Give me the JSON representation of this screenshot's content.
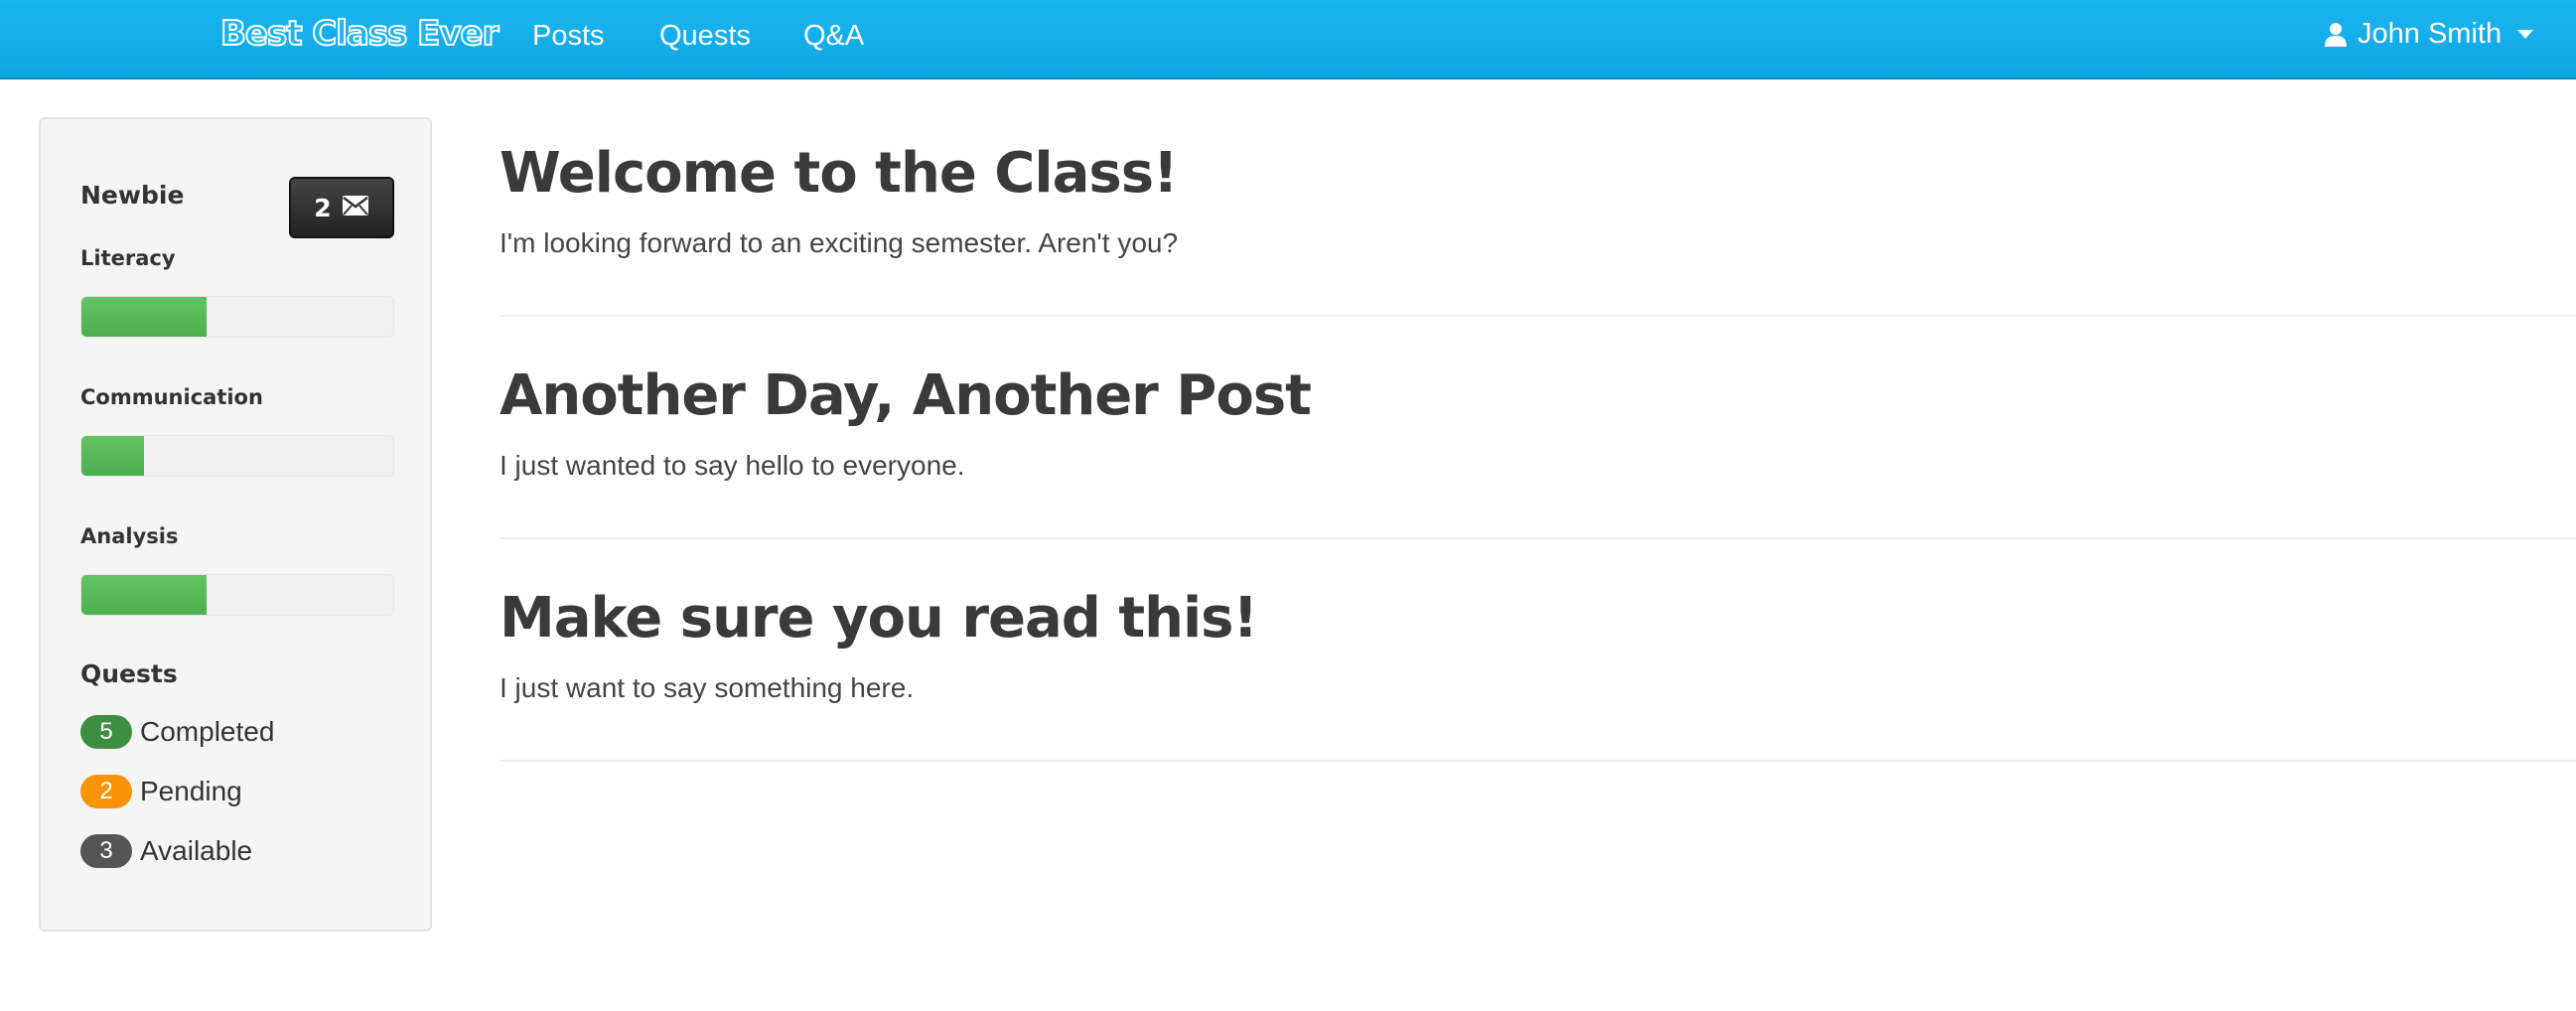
{
  "navbar": {
    "brand": "Best Class Ever",
    "links": [
      "Posts",
      "Quests",
      "Q&A"
    ],
    "user": "John Smith",
    "colors": {
      "bar": "#1ab6f1",
      "text": "#ffffff"
    }
  },
  "sidebar": {
    "rank": "Newbie",
    "messages_count": "2",
    "skills": [
      {
        "label": "Literacy",
        "progress": 0.4
      },
      {
        "label": "Communication",
        "progress": 0.2
      },
      {
        "label": "Analysis",
        "progress": 0.4
      }
    ],
    "quests_title": "Quests",
    "quests": [
      {
        "count": "5",
        "label": "Completed",
        "color": "#3e8e41"
      },
      {
        "count": "2",
        "label": "Pending",
        "color": "#f89406"
      },
      {
        "count": "3",
        "label": "Available",
        "color": "#555555"
      }
    ]
  },
  "posts": [
    {
      "title": "Welcome to the Class!",
      "body": "I'm looking forward to an exciting semester.  Aren't you?"
    },
    {
      "title": "Another Day, Another Post",
      "body": "I just wanted to say hello to everyone."
    },
    {
      "title": "Make sure you read this!",
      "body": "I just want to say something here."
    }
  ]
}
